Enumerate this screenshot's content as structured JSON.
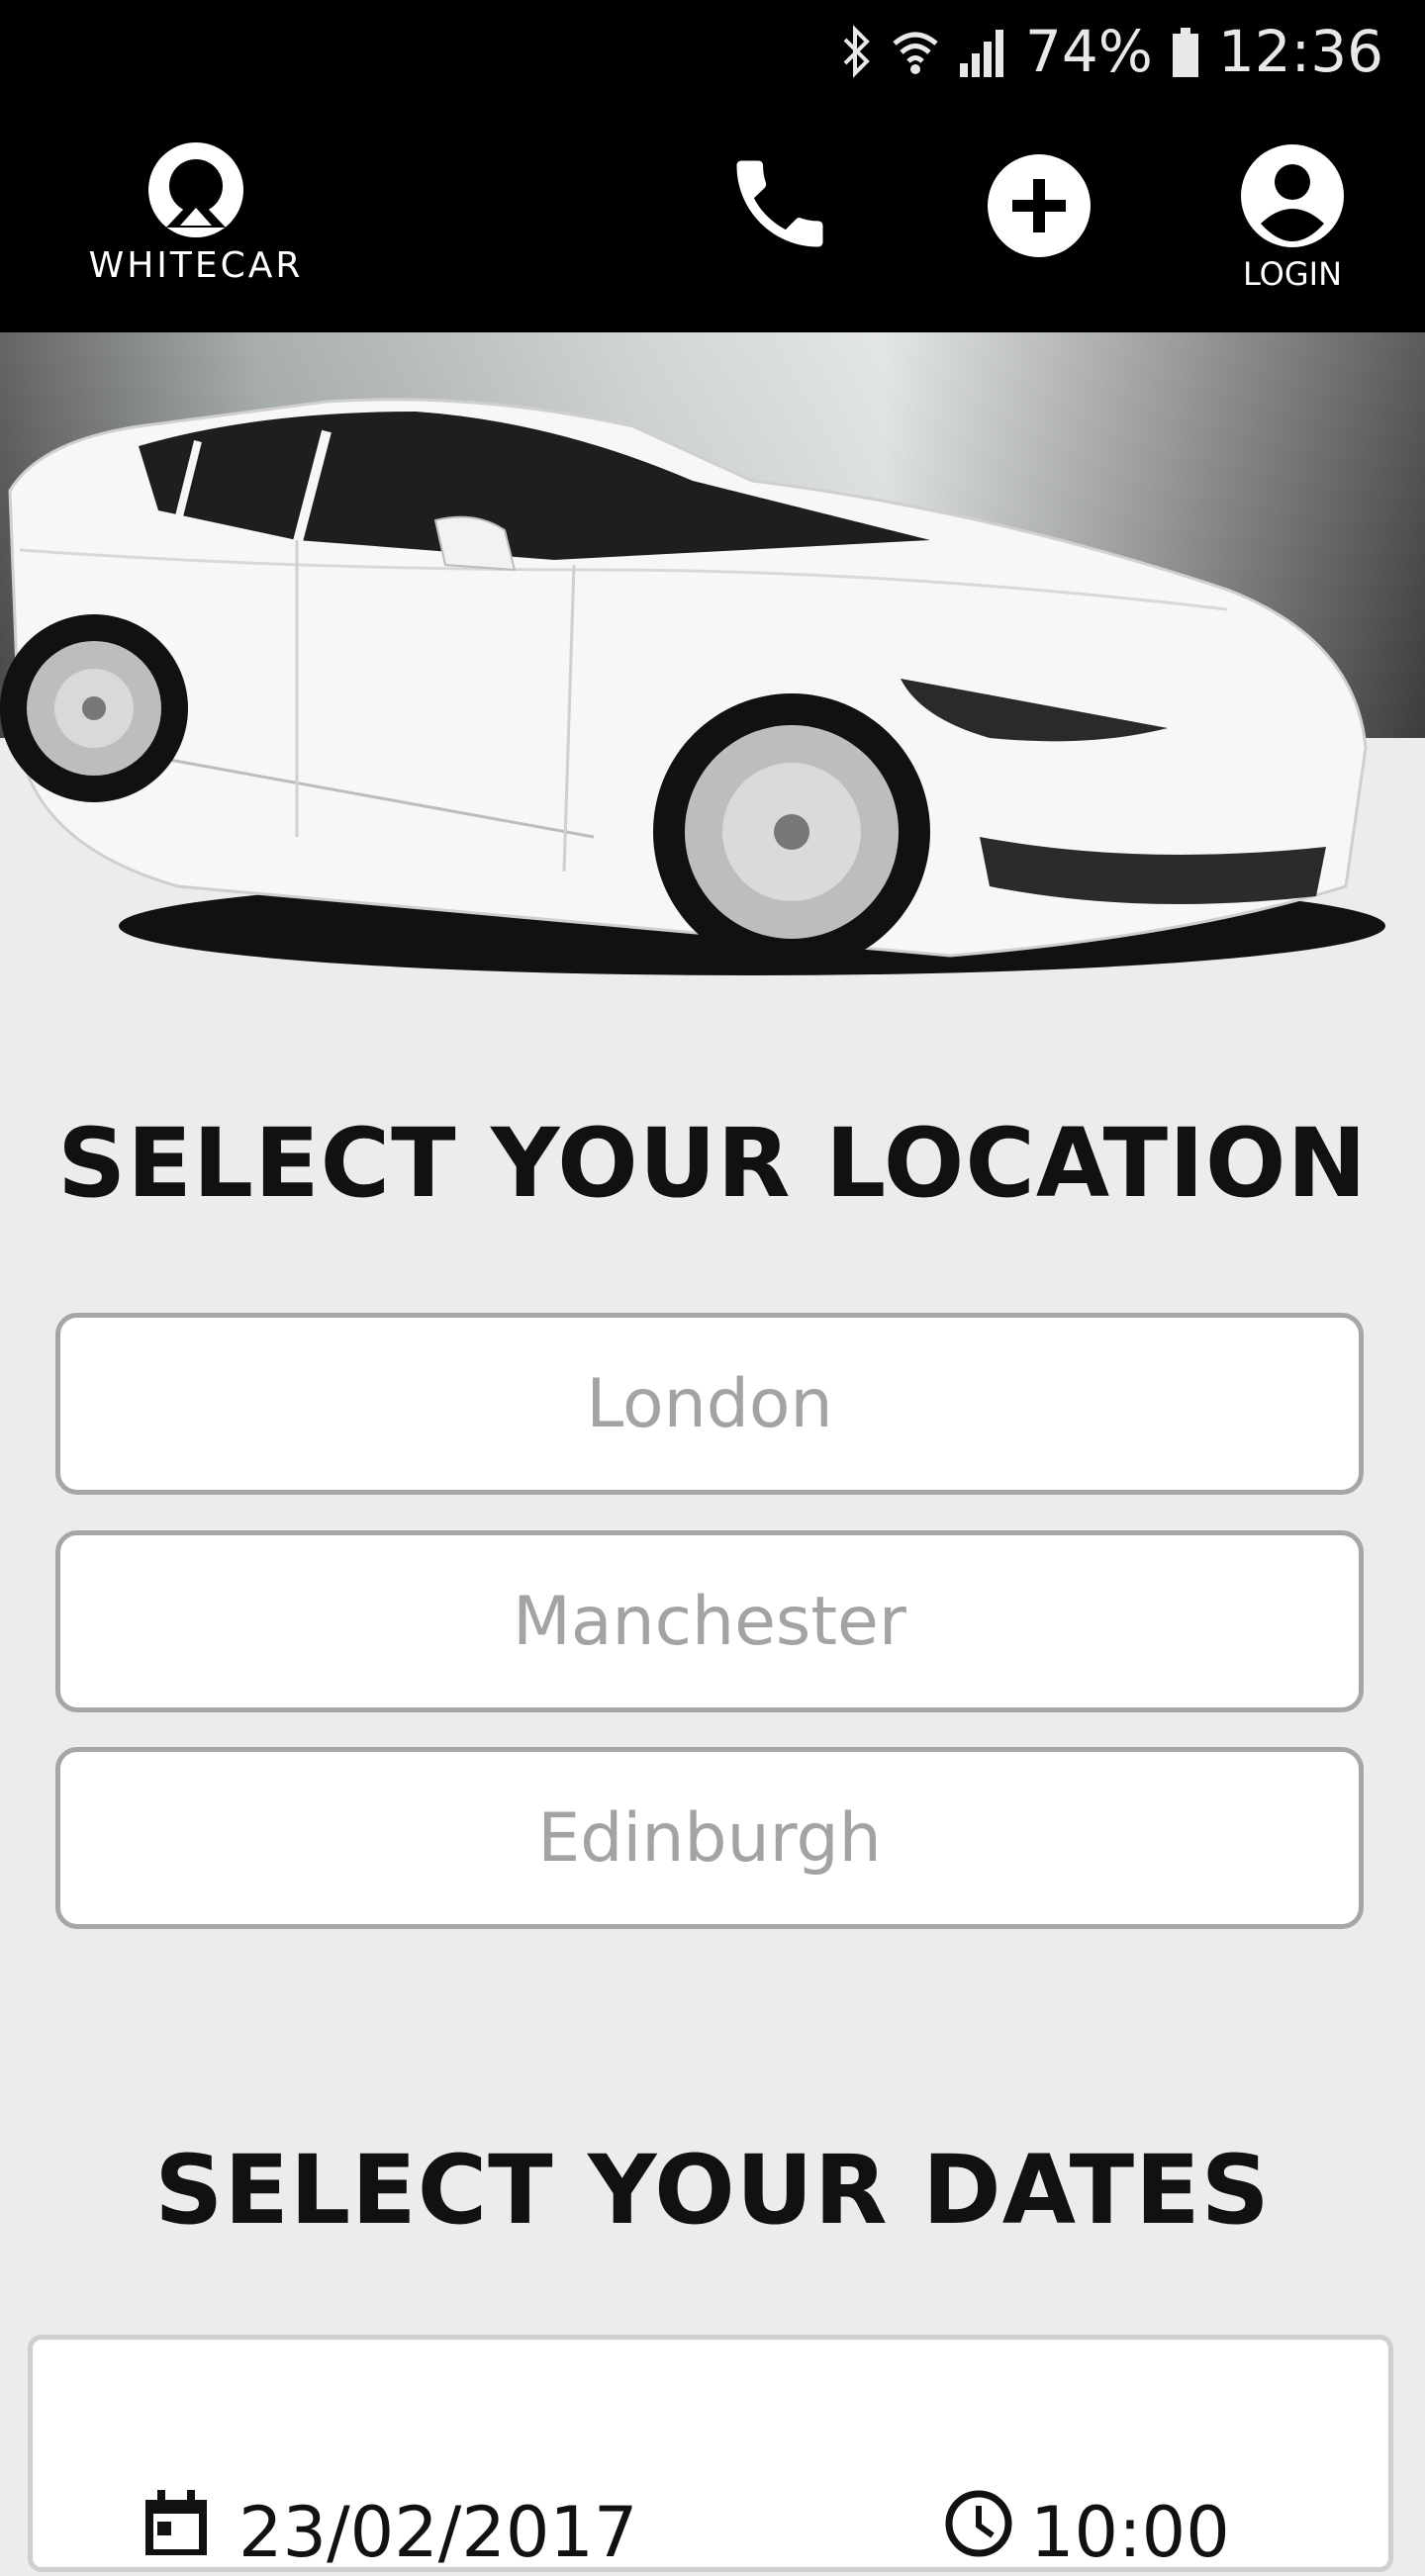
{
  "status_bar": {
    "battery": "74%",
    "time": "12:36"
  },
  "header": {
    "brand": "WHITECAR",
    "login_label": "LOGIN"
  },
  "location_section": {
    "title": "SELECT YOUR LOCATION",
    "options": [
      "London",
      "Manchester",
      "Edinburgh"
    ]
  },
  "dates_section": {
    "title": "SELECT YOUR DATES",
    "date": "23/02/2017",
    "time": "10:00"
  },
  "icons": [
    "bluetooth-icon",
    "wifi-icon",
    "signal-icon",
    "battery-icon",
    "logo-icon",
    "phone-icon",
    "add-icon",
    "account-icon",
    "calendar-icon",
    "clock-icon"
  ]
}
